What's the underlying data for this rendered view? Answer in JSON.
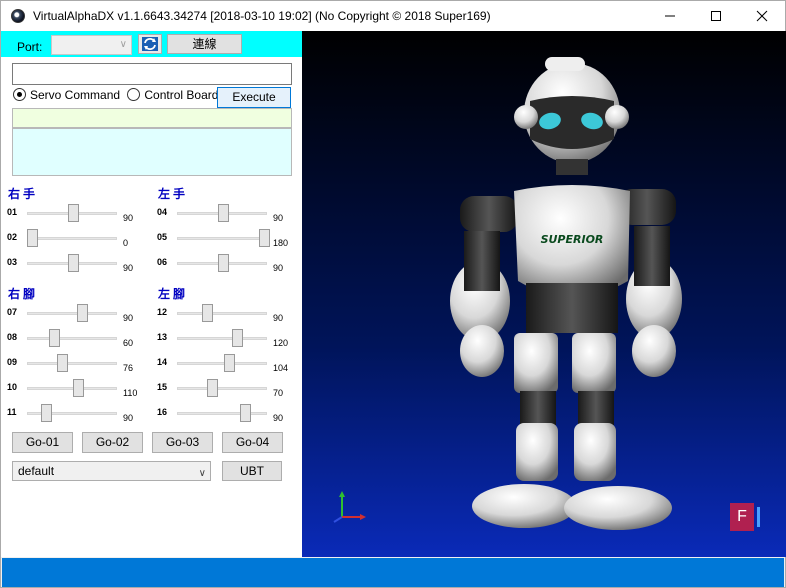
{
  "window": {
    "title": "VirtualAlphaDX v1.1.6643.34274  [2018-03-10 19:02]  (No Copyright © 2018 Super169)"
  },
  "toolbar": {
    "port_label": "Port:",
    "port_value": "",
    "connect_label": "連線"
  },
  "command": {
    "input_value": "",
    "mode_servo": "Servo Command",
    "mode_board": "Control Board",
    "selected_mode": "Servo Command",
    "execute_label": "Execute",
    "status_text": "",
    "log_text": ""
  },
  "groups": {
    "right_hand": "右手",
    "left_hand": "左手",
    "right_leg": "右腳",
    "left_leg": "左腳"
  },
  "servos": [
    {
      "id": "01",
      "value": "90",
      "level": 90
    },
    {
      "id": "02",
      "value": "0",
      "level": 0
    },
    {
      "id": "03",
      "value": "90",
      "level": 90
    },
    {
      "id": "04",
      "value": "90",
      "level": 90
    },
    {
      "id": "05",
      "value": "180",
      "level": 180
    },
    {
      "id": "06",
      "value": "90",
      "level": 90
    },
    {
      "id": "07",
      "value": "90",
      "level": 110
    },
    {
      "id": "08",
      "value": "60",
      "level": 48
    },
    {
      "id": "09",
      "value": "76",
      "level": 66
    },
    {
      "id": "10",
      "value": "110",
      "level": 100
    },
    {
      "id": "11",
      "value": "90",
      "level": 30
    },
    {
      "id": "12",
      "value": "90",
      "level": 54
    },
    {
      "id": "13",
      "value": "120",
      "level": 120
    },
    {
      "id": "14",
      "value": "104",
      "level": 104
    },
    {
      "id": "15",
      "value": "70",
      "level": 66
    },
    {
      "id": "16",
      "value": "90",
      "level": 138
    }
  ],
  "actions": {
    "go1": "Go-01",
    "go2": "Go-02",
    "go3": "Go-03",
    "go4": "Go-04",
    "preset_value": "default",
    "ubt_label": "UBT"
  },
  "viewport": {
    "robot_chest_text": "SUPERIOR",
    "badge_text": "F"
  },
  "colors": {
    "accent_cyan": "#00ffff",
    "status_blue": "#0078d7",
    "group_label_blue": "#0000c0",
    "status_green": "#f0ffe0",
    "log_cyan": "#e0ffff"
  }
}
